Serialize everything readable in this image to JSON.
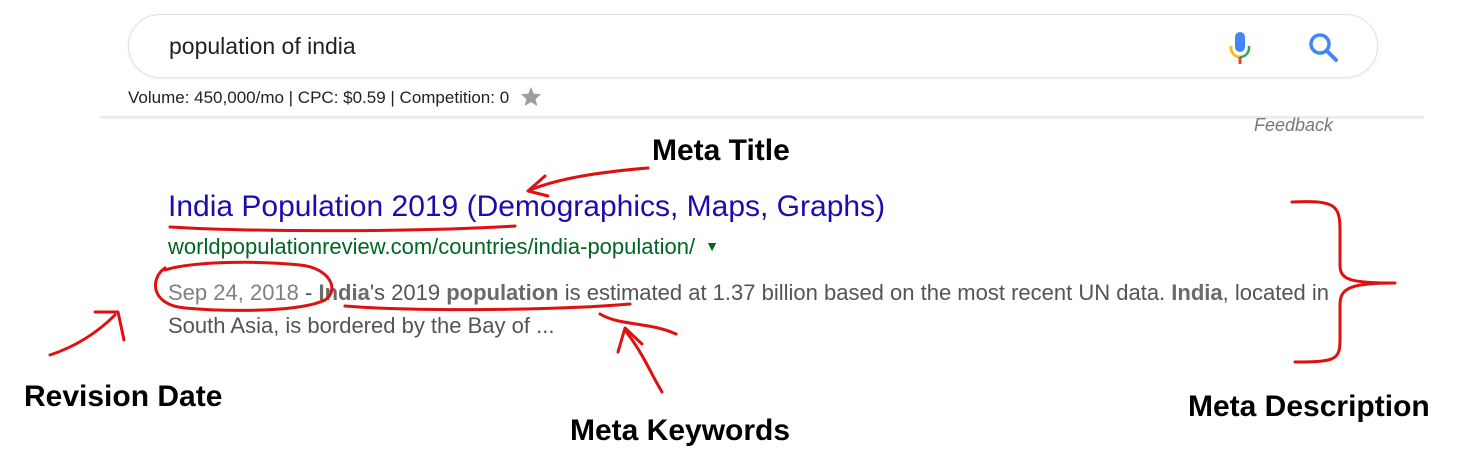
{
  "search": {
    "query": "population of india",
    "stats": "Volume: 450,000/mo | CPC: $0.59 | Competition: 0",
    "feedback_label": "Feedback"
  },
  "result": {
    "title": "India Population 2019 (Demographics, Maps, Graphs)",
    "url": "worldpopulationreview.com/countries/india-population/",
    "date": "Sep 24, 2018",
    "separator": " - ",
    "snippet_bold_1": "India",
    "snippet_text_1": "'s 2019 ",
    "snippet_bold_2": "population",
    "snippet_text_2": " is estimated at 1.37 billion based on the most recent UN data. ",
    "snippet_bold_3": "India",
    "snippet_text_3": ", located in South Asia, is bordered by the Bay of ..."
  },
  "annotations": {
    "meta_title": "Meta Title",
    "revision_date": "Revision Date",
    "meta_keywords": "Meta Keywords",
    "meta_description": "Meta Description",
    "ink_color": "#e01010"
  },
  "colors": {
    "link": "#1a0dab",
    "url": "#006621",
    "snippet": "#545454"
  },
  "icons": {
    "mic": "mic-icon",
    "search": "search-icon",
    "star": "star-icon",
    "caret": "caret-down-icon"
  }
}
